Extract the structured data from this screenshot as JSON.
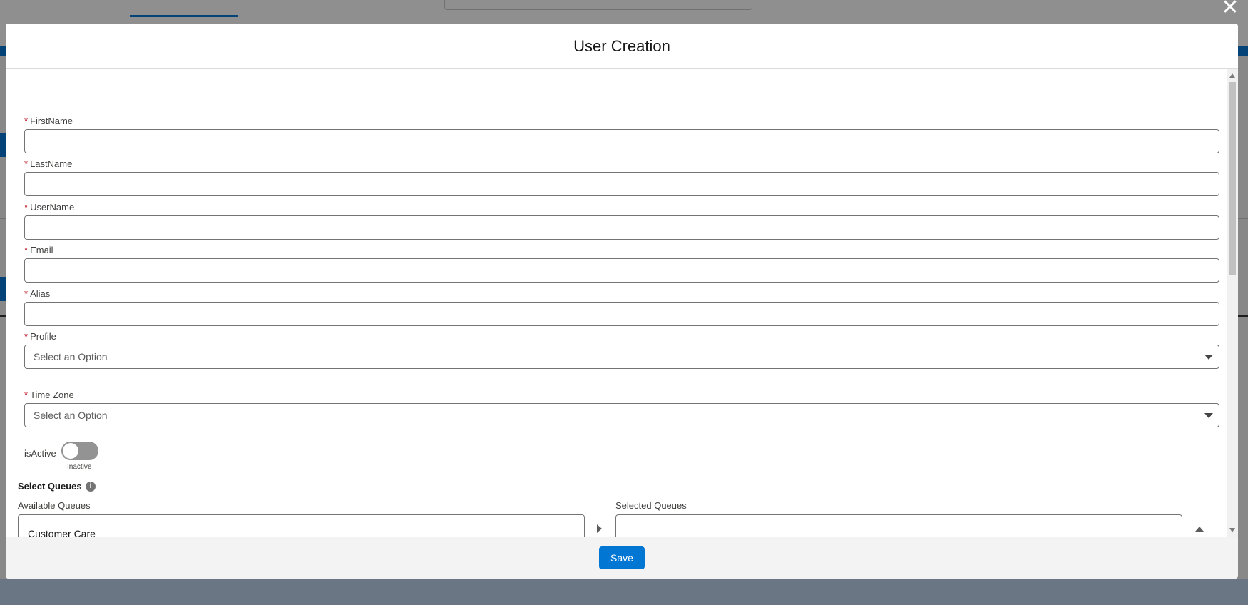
{
  "modal": {
    "title": "User Creation",
    "close_icon": "close-icon",
    "fields": [
      {
        "label": "FirstName",
        "required_mark": "*",
        "value": ""
      },
      {
        "label": "LastName",
        "required_mark": "*",
        "value": ""
      },
      {
        "label": "UserName",
        "required_mark": "*",
        "value": ""
      },
      {
        "label": "Email",
        "required_mark": "*",
        "value": ""
      },
      {
        "label": "Alias",
        "required_mark": "*",
        "value": ""
      }
    ],
    "profile": {
      "label": "Profile",
      "required_mark": "*",
      "selected": "Select an Option"
    },
    "time_zone": {
      "label": "Time Zone",
      "required_mark": "*",
      "selected": "Select an Option"
    },
    "is_active": {
      "label": "isActive",
      "state_text": "Inactive",
      "checked": false
    },
    "queues": {
      "title": "Select Queues",
      "info_icon": "info-icon",
      "available_label": "Available Queues",
      "available_items": [
        "Customer Care"
      ],
      "selected_label": "Selected Queues",
      "selected_items": []
    },
    "footer": {
      "save_label": "Save"
    }
  },
  "colors": {
    "brand": "#0176d3",
    "required": "#ba0517",
    "backdrop": "#6b7685"
  }
}
